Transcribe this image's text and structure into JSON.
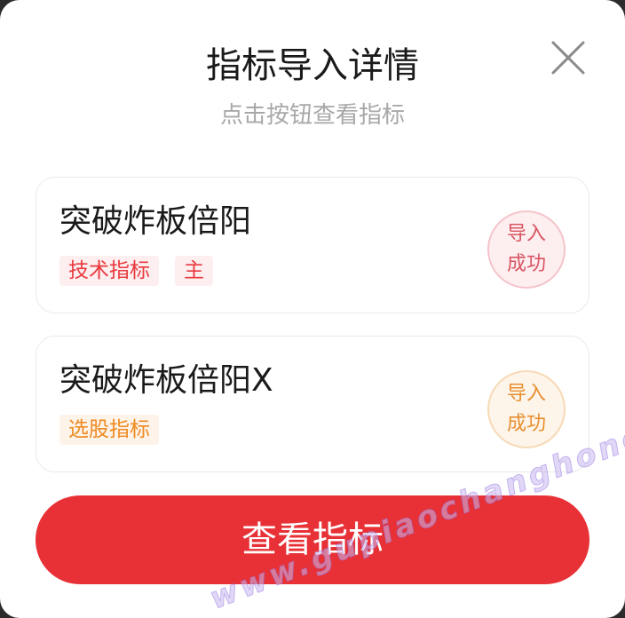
{
  "dialog": {
    "title": "指标导入详情",
    "subtitle": "点击按钮查看指标",
    "close_icon": "close-icon"
  },
  "items": [
    {
      "name": "突破炸板倍阳",
      "tags": [
        "技术指标",
        "主"
      ],
      "status": [
        "导入",
        "成功"
      ],
      "accent": "#e8393e"
    },
    {
      "name": "突破炸板倍阳X",
      "tags": [
        "选股指标"
      ],
      "status": [
        "导入",
        "成功"
      ],
      "accent": "#ee8a1f"
    }
  ],
  "action": {
    "label": "查看指标",
    "color": "#e83136"
  },
  "watermark": {
    "text": "www.gupiaochanghong.com"
  }
}
